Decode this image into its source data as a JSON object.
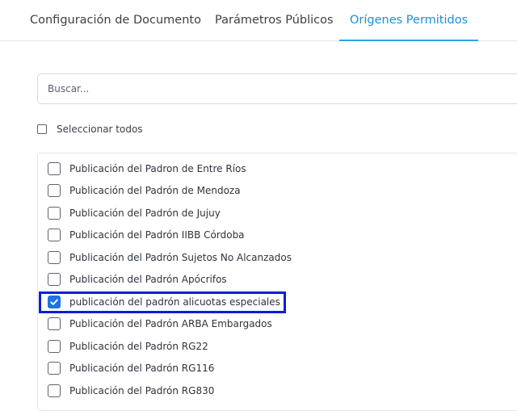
{
  "tabs": [
    {
      "label": "Configuración de Documento",
      "active": false
    },
    {
      "label": "Parámetros Públicos",
      "active": false
    },
    {
      "label": "Orígenes Permitidos",
      "active": true
    }
  ],
  "search": {
    "value": "",
    "placeholder": "Buscar..."
  },
  "select_all": {
    "label": "Seleccionar todos",
    "checked": false
  },
  "items": [
    {
      "label": "Publicación del Padron de Entre Ríos",
      "checked": false
    },
    {
      "label": "Publicación del Padrón de Mendoza",
      "checked": false
    },
    {
      "label": "Publicación del Padrón de Jujuy",
      "checked": false
    },
    {
      "label": "Publicación del Padrón IIBB Córdoba",
      "checked": false
    },
    {
      "label": "Publicación del Padrón Sujetos No Alcanzados",
      "checked": false
    },
    {
      "label": "Publicación del Padrón Apócrifos",
      "checked": false
    },
    {
      "label": "publicación del padrón alicuotas especiales",
      "checked": true,
      "highlighted": true
    },
    {
      "label": "Publicación del Padrón ARBA Embargados",
      "checked": false
    },
    {
      "label": "Publicación del Padrón RG22",
      "checked": false
    },
    {
      "label": "Publicación del Padrón RG116",
      "checked": false
    },
    {
      "label": "Publicación del Padrón RG830",
      "checked": false
    }
  ],
  "colors": {
    "accent": "#1d8fd6",
    "checkbox_checked": "#1b73e8",
    "highlight_border": "#0a1ed8"
  }
}
